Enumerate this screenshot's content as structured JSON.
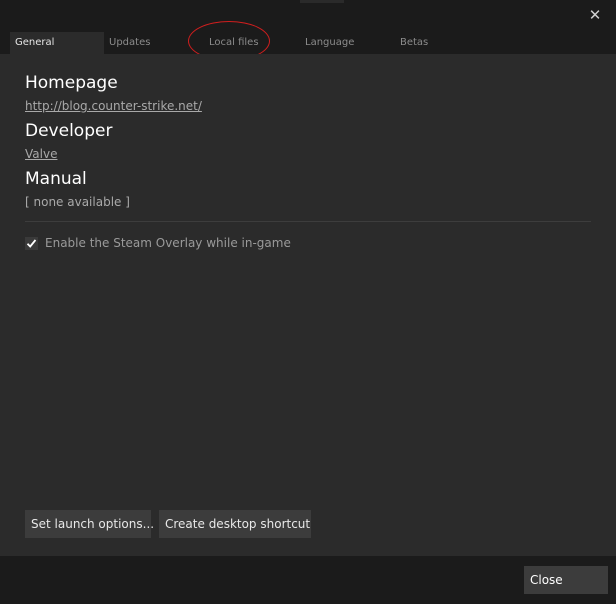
{
  "window": {
    "close_icon": "close-icon"
  },
  "tabs": [
    {
      "label": "General",
      "active": true
    },
    {
      "label": "Updates",
      "active": false
    },
    {
      "label": "Local files",
      "active": false
    },
    {
      "label": "Language",
      "active": false
    },
    {
      "label": "Betas",
      "active": false
    }
  ],
  "annotation": {
    "color": "#d01e1e",
    "highlights": "Local files"
  },
  "general": {
    "homepage_title": "Homepage",
    "homepage_url": "http://blog.counter-strike.net/",
    "developer_title": "Developer",
    "developer_name": "Valve",
    "manual_title": "Manual",
    "manual_value": "[ none available ]",
    "overlay_checkbox_label": "Enable the Steam Overlay while in-game",
    "overlay_checked": true
  },
  "buttons": {
    "launch_options": "Set launch options...",
    "desktop_shortcut": "Create desktop shortcut",
    "close": "Close"
  },
  "colors": {
    "background": "#1b1b1b",
    "panel": "#2b2b2b",
    "button": "#3c3c3c",
    "text_primary": "#ffffff",
    "text_secondary": "#a9a9a9"
  }
}
